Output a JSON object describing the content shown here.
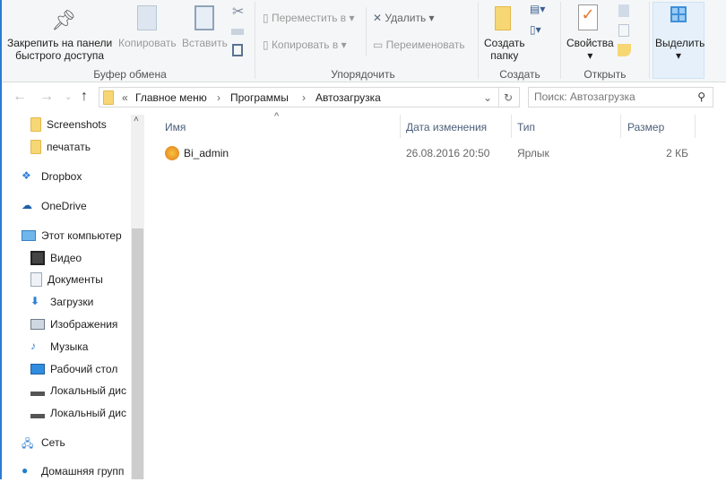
{
  "ribbon": {
    "pin_line1": "Закрепить на панели",
    "pin_line2": "быстрого доступа",
    "copy": "Копировать",
    "paste": "Вставить",
    "clipboard_group": "Буфер обмена",
    "move_to": "Переместить в",
    "copy_to": "Копировать в",
    "delete": "Удалить",
    "rename": "Переименовать",
    "organize_group": "Упорядочить",
    "new_folder_line1": "Создать",
    "new_folder_line2": "папку",
    "create_group": "Создать",
    "properties": "Свойства",
    "open_group": "Открыть",
    "select": "Выделить"
  },
  "nav": {
    "crumbs": [
      "«",
      "Главное меню",
      "Программы",
      "Автозагрузка"
    ],
    "search_placeholder": "Поиск: Автозагрузка"
  },
  "sidebar": {
    "items": [
      "Screenshots",
      "печатать",
      "Dropbox",
      "OneDrive",
      "Этот компьютер",
      "Видео",
      "Документы",
      "Загрузки",
      "Изображения",
      "Музыка",
      "Рабочий стол",
      "Локальный дис",
      "Локальный дис",
      "Сеть",
      "Домашняя групп"
    ]
  },
  "columns": {
    "name": "Имя",
    "date": "Дата изменения",
    "type": "Тип",
    "size": "Размер"
  },
  "files": [
    {
      "name": "Bi_admin",
      "date": "26.08.2016 20:50",
      "type": "Ярлык",
      "size": "2 КБ"
    }
  ]
}
